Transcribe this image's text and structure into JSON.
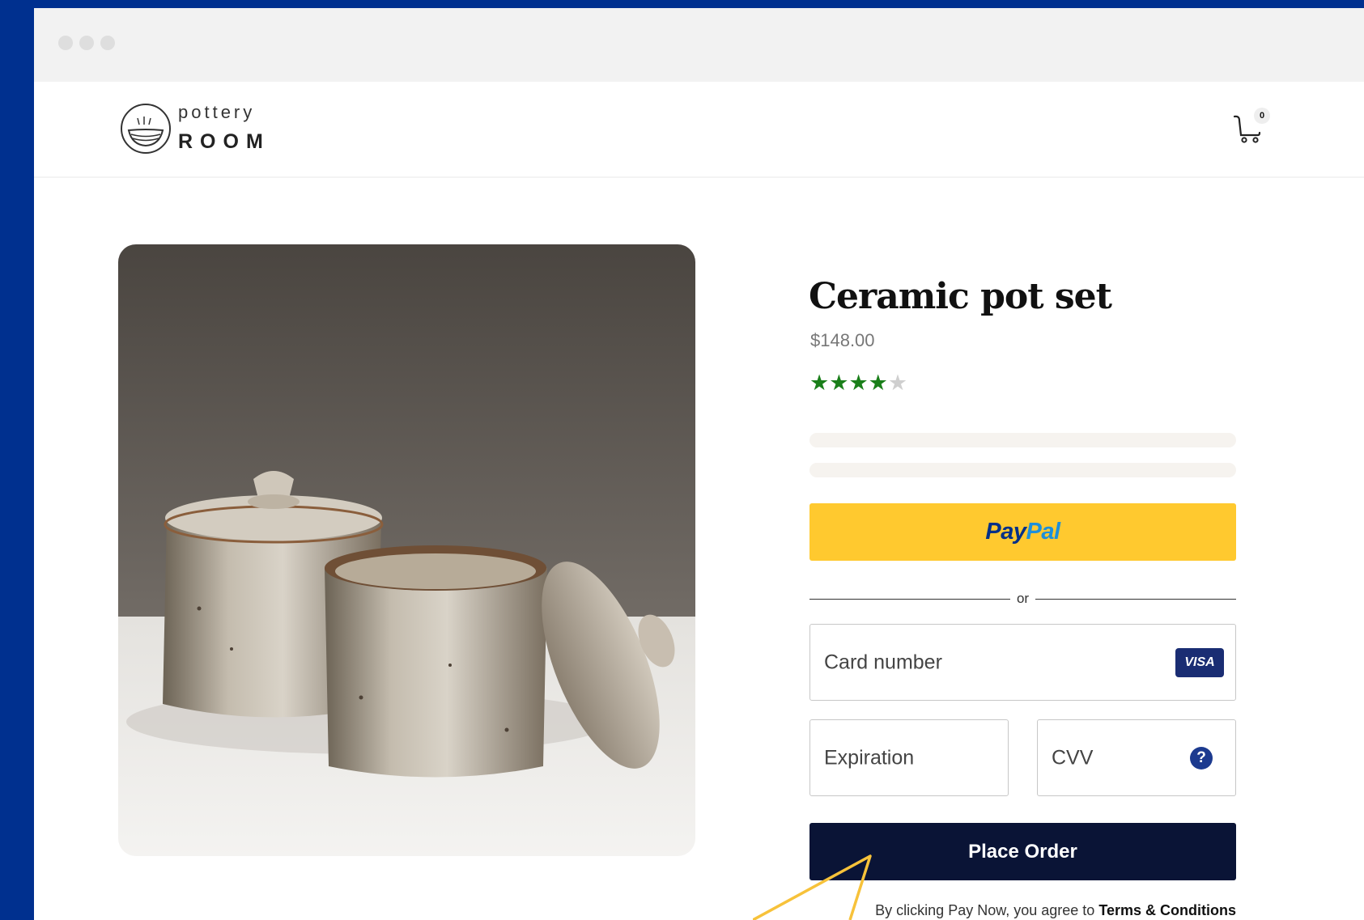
{
  "brand": {
    "logo_top": "pottery",
    "logo_bottom": "ROOM"
  },
  "cart": {
    "count": "0",
    "icon": "cart-icon"
  },
  "product": {
    "title": "Ceramic pot set",
    "price": "$148.00",
    "rating": {
      "filled": 4,
      "max": 5
    },
    "image": "ceramic-pot-set-photo"
  },
  "checkout": {
    "paypal": {
      "part1": "Pay",
      "part2": "Pal"
    },
    "divider_text": "or",
    "card_number_placeholder": "Card number",
    "card_brand": "VISA",
    "expiration_placeholder": "Expiration",
    "cvv_placeholder": "CVV",
    "cvv_help_symbol": "?",
    "place_order_label": "Place Order",
    "terms_prefix": "By clicking Pay Now, you agree to ",
    "terms_link": "Terms & Conditions"
  },
  "colors": {
    "page_background": "#00308f",
    "paypal_yellow": "#ffc92f",
    "place_order_navy": "#0a1436",
    "star_green": "#1a7f1a",
    "annotation_arrow": "#f7c23a"
  }
}
